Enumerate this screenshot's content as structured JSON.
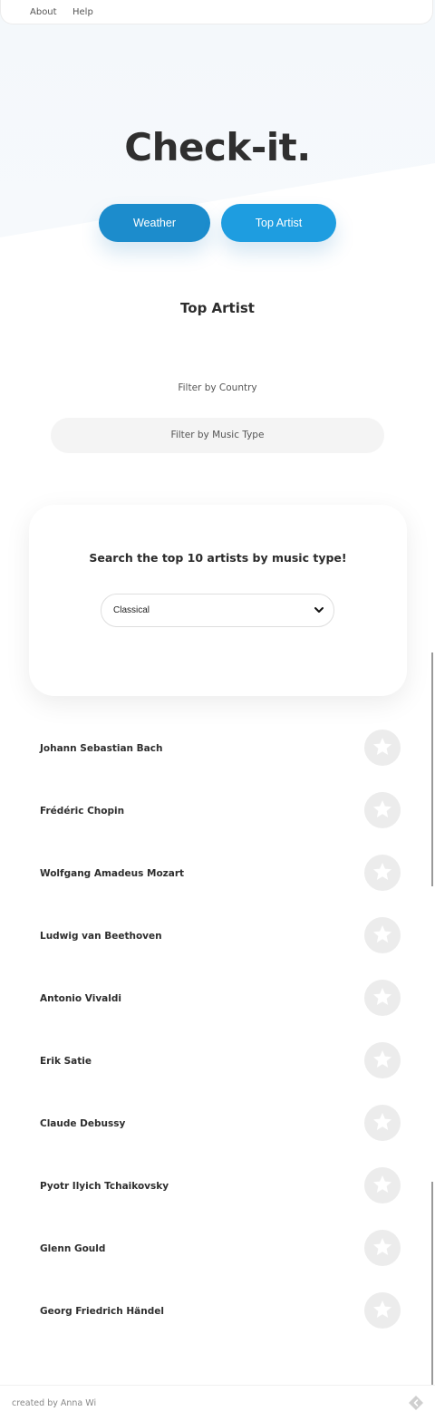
{
  "nav": {
    "about": "About",
    "help": "Help"
  },
  "hero": {
    "title": "Check-it.",
    "weather_label": "Weather",
    "top_artist_label": "Top Artist"
  },
  "section": {
    "title": "Top Artist",
    "filter_country": "Filter by Country",
    "filter_music_type": "Filter by Music Type"
  },
  "search": {
    "heading": "Search the top 10 artists by music type!",
    "selected": "Classical"
  },
  "artists": [
    "Johann Sebastian Bach",
    "Frédéric Chopin",
    "Wolfgang Amadeus Mozart",
    "Ludwig van Beethoven",
    "Antonio Vivaldi",
    "Erik Satie",
    "Claude Debussy",
    "Pyotr Ilyich Tchaikovsky",
    "Glenn Gould",
    "Georg Friedrich Händel"
  ],
  "footer": {
    "credit": "created by Anna Wi",
    "icon": "diamond-arrow-icon"
  },
  "colors": {
    "weather_button": "#1c8ccc",
    "top_artist_button": "#1e9de0",
    "favorite_circle": "#ececec"
  }
}
